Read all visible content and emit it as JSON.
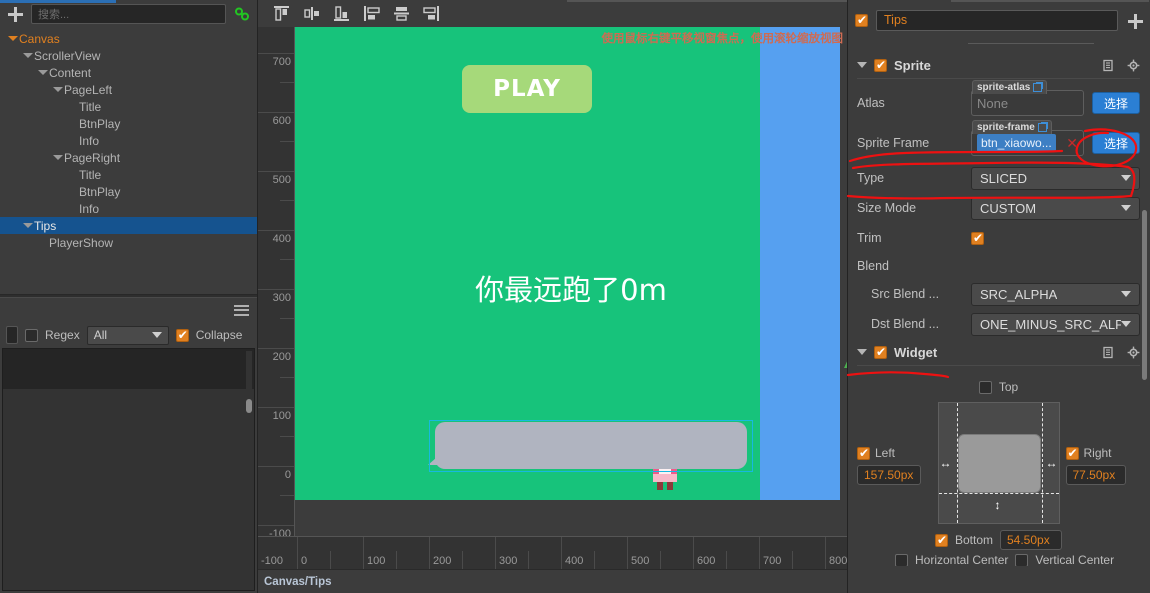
{
  "hierarchy": {
    "search_placeholder": "搜索...",
    "add_icon": "plus-icon",
    "link_icon": "link-icon",
    "nodes": [
      {
        "label": "Canvas",
        "depth": 0,
        "expandable": true,
        "selected": false,
        "root": true
      },
      {
        "label": "ScrollerView",
        "depth": 1,
        "expandable": true,
        "selected": false,
        "root": false
      },
      {
        "label": "Content",
        "depth": 2,
        "expandable": true,
        "selected": false,
        "root": false
      },
      {
        "label": "PageLeft",
        "depth": 3,
        "expandable": true,
        "selected": false,
        "root": false
      },
      {
        "label": "Title",
        "depth": 4,
        "expandable": false,
        "selected": false,
        "root": false
      },
      {
        "label": "BtnPlay",
        "depth": 4,
        "expandable": false,
        "selected": false,
        "root": false
      },
      {
        "label": "Info",
        "depth": 4,
        "expandable": false,
        "selected": false,
        "root": false
      },
      {
        "label": "PageRight",
        "depth": 3,
        "expandable": true,
        "selected": false,
        "root": false
      },
      {
        "label": "Title",
        "depth": 4,
        "expandable": false,
        "selected": false,
        "root": false
      },
      {
        "label": "BtnPlay",
        "depth": 4,
        "expandable": false,
        "selected": false,
        "root": false
      },
      {
        "label": "Info",
        "depth": 4,
        "expandable": false,
        "selected": false,
        "root": false
      },
      {
        "label": "Tips",
        "depth": 1,
        "expandable": true,
        "selected": true,
        "root": false
      },
      {
        "label": "PlayerShow",
        "depth": 2,
        "expandable": false,
        "selected": false,
        "root": false
      }
    ]
  },
  "console": {
    "menu_icon": "hamburger-icon",
    "regex_label": "Regex",
    "regex_checked": false,
    "level_filter": "All",
    "collapse_label": "Collapse",
    "collapse_checked": true
  },
  "scene": {
    "toolbar_icons": [
      "align-top-icon",
      "align-vertical-center-icon",
      "align-bottom-icon",
      "align-left-icon",
      "align-horizontal-center-icon",
      "align-right-icon"
    ],
    "hint": "使用鼠标右键平移视窗焦点，使用滚轮缩放视图",
    "play_button_label": "PLAY",
    "center_text": "你最远跑了0m",
    "ruler_v_ticks": [
      "700",
      "600",
      "500",
      "400",
      "300",
      "200",
      "100",
      "0",
      "-100"
    ],
    "ruler_h_ticks": [
      "0",
      "100",
      "200",
      "300",
      "400",
      "500",
      "600",
      "700",
      "800"
    ],
    "ruler_h_first": "-100",
    "status_path": "Canvas/Tips",
    "colors": {
      "design_area": "#17c37b",
      "outside_area": "#56a0f0",
      "selection_outline": "#17b9e0",
      "gizmo_x": "#e01818",
      "gizmo_y": "#4caf50",
      "gizmo_center": "#4a76d8",
      "play_button": "#a6d97a",
      "bubble": "#b0b4c0",
      "hint": "#cf6b52"
    }
  },
  "inspector": {
    "node_enabled": true,
    "node_name": "Tips",
    "add_component_icon": "plus-icon",
    "components": [
      {
        "title": "Sprite",
        "enabled": true,
        "expanded": true,
        "help_icon": "book-icon",
        "menu_icon": "gear-icon"
      },
      {
        "title": "Widget",
        "enabled": true,
        "expanded": true,
        "help_icon": "book-icon",
        "menu_icon": "gear-icon"
      }
    ],
    "sprite": {
      "atlas": {
        "label": "Atlas",
        "type_tag": "sprite-atlas",
        "value": "None",
        "button": "选择"
      },
      "sprite_frame": {
        "label": "Sprite Frame",
        "type_tag": "sprite-frame",
        "value": "btn_xiaowo...",
        "clear_icon": "clear-x-icon",
        "button": "选择"
      },
      "type": {
        "label": "Type",
        "value": "SLICED"
      },
      "size_mode": {
        "label": "Size Mode",
        "value": "CUSTOM"
      },
      "trim": {
        "label": "Trim",
        "checked": true
      },
      "blend": {
        "label": "Blend"
      },
      "src_blend": {
        "label": "Src Blend ...",
        "value": "SRC_ALPHA"
      },
      "dst_blend": {
        "label": "Dst Blend ...",
        "value": "ONE_MINUS_SRC_ALPHA"
      }
    },
    "widget": {
      "top": {
        "label": "Top",
        "checked": false,
        "value": ""
      },
      "left": {
        "label": "Left",
        "checked": true,
        "value": "157.50px"
      },
      "right": {
        "label": "Right",
        "checked": true,
        "value": "77.50px"
      },
      "bottom": {
        "label": "Bottom",
        "checked": true,
        "value": "54.50px"
      },
      "horizontal_center": {
        "label": "Horizontal Center",
        "checked": false
      },
      "vertical_center": {
        "label": "Vertical Center",
        "checked": false
      }
    }
  },
  "annotations": {
    "color": "#ee1111",
    "marks": [
      "circle-around-select-button",
      "line-under-type-row",
      "line-under-widget-header"
    ]
  }
}
